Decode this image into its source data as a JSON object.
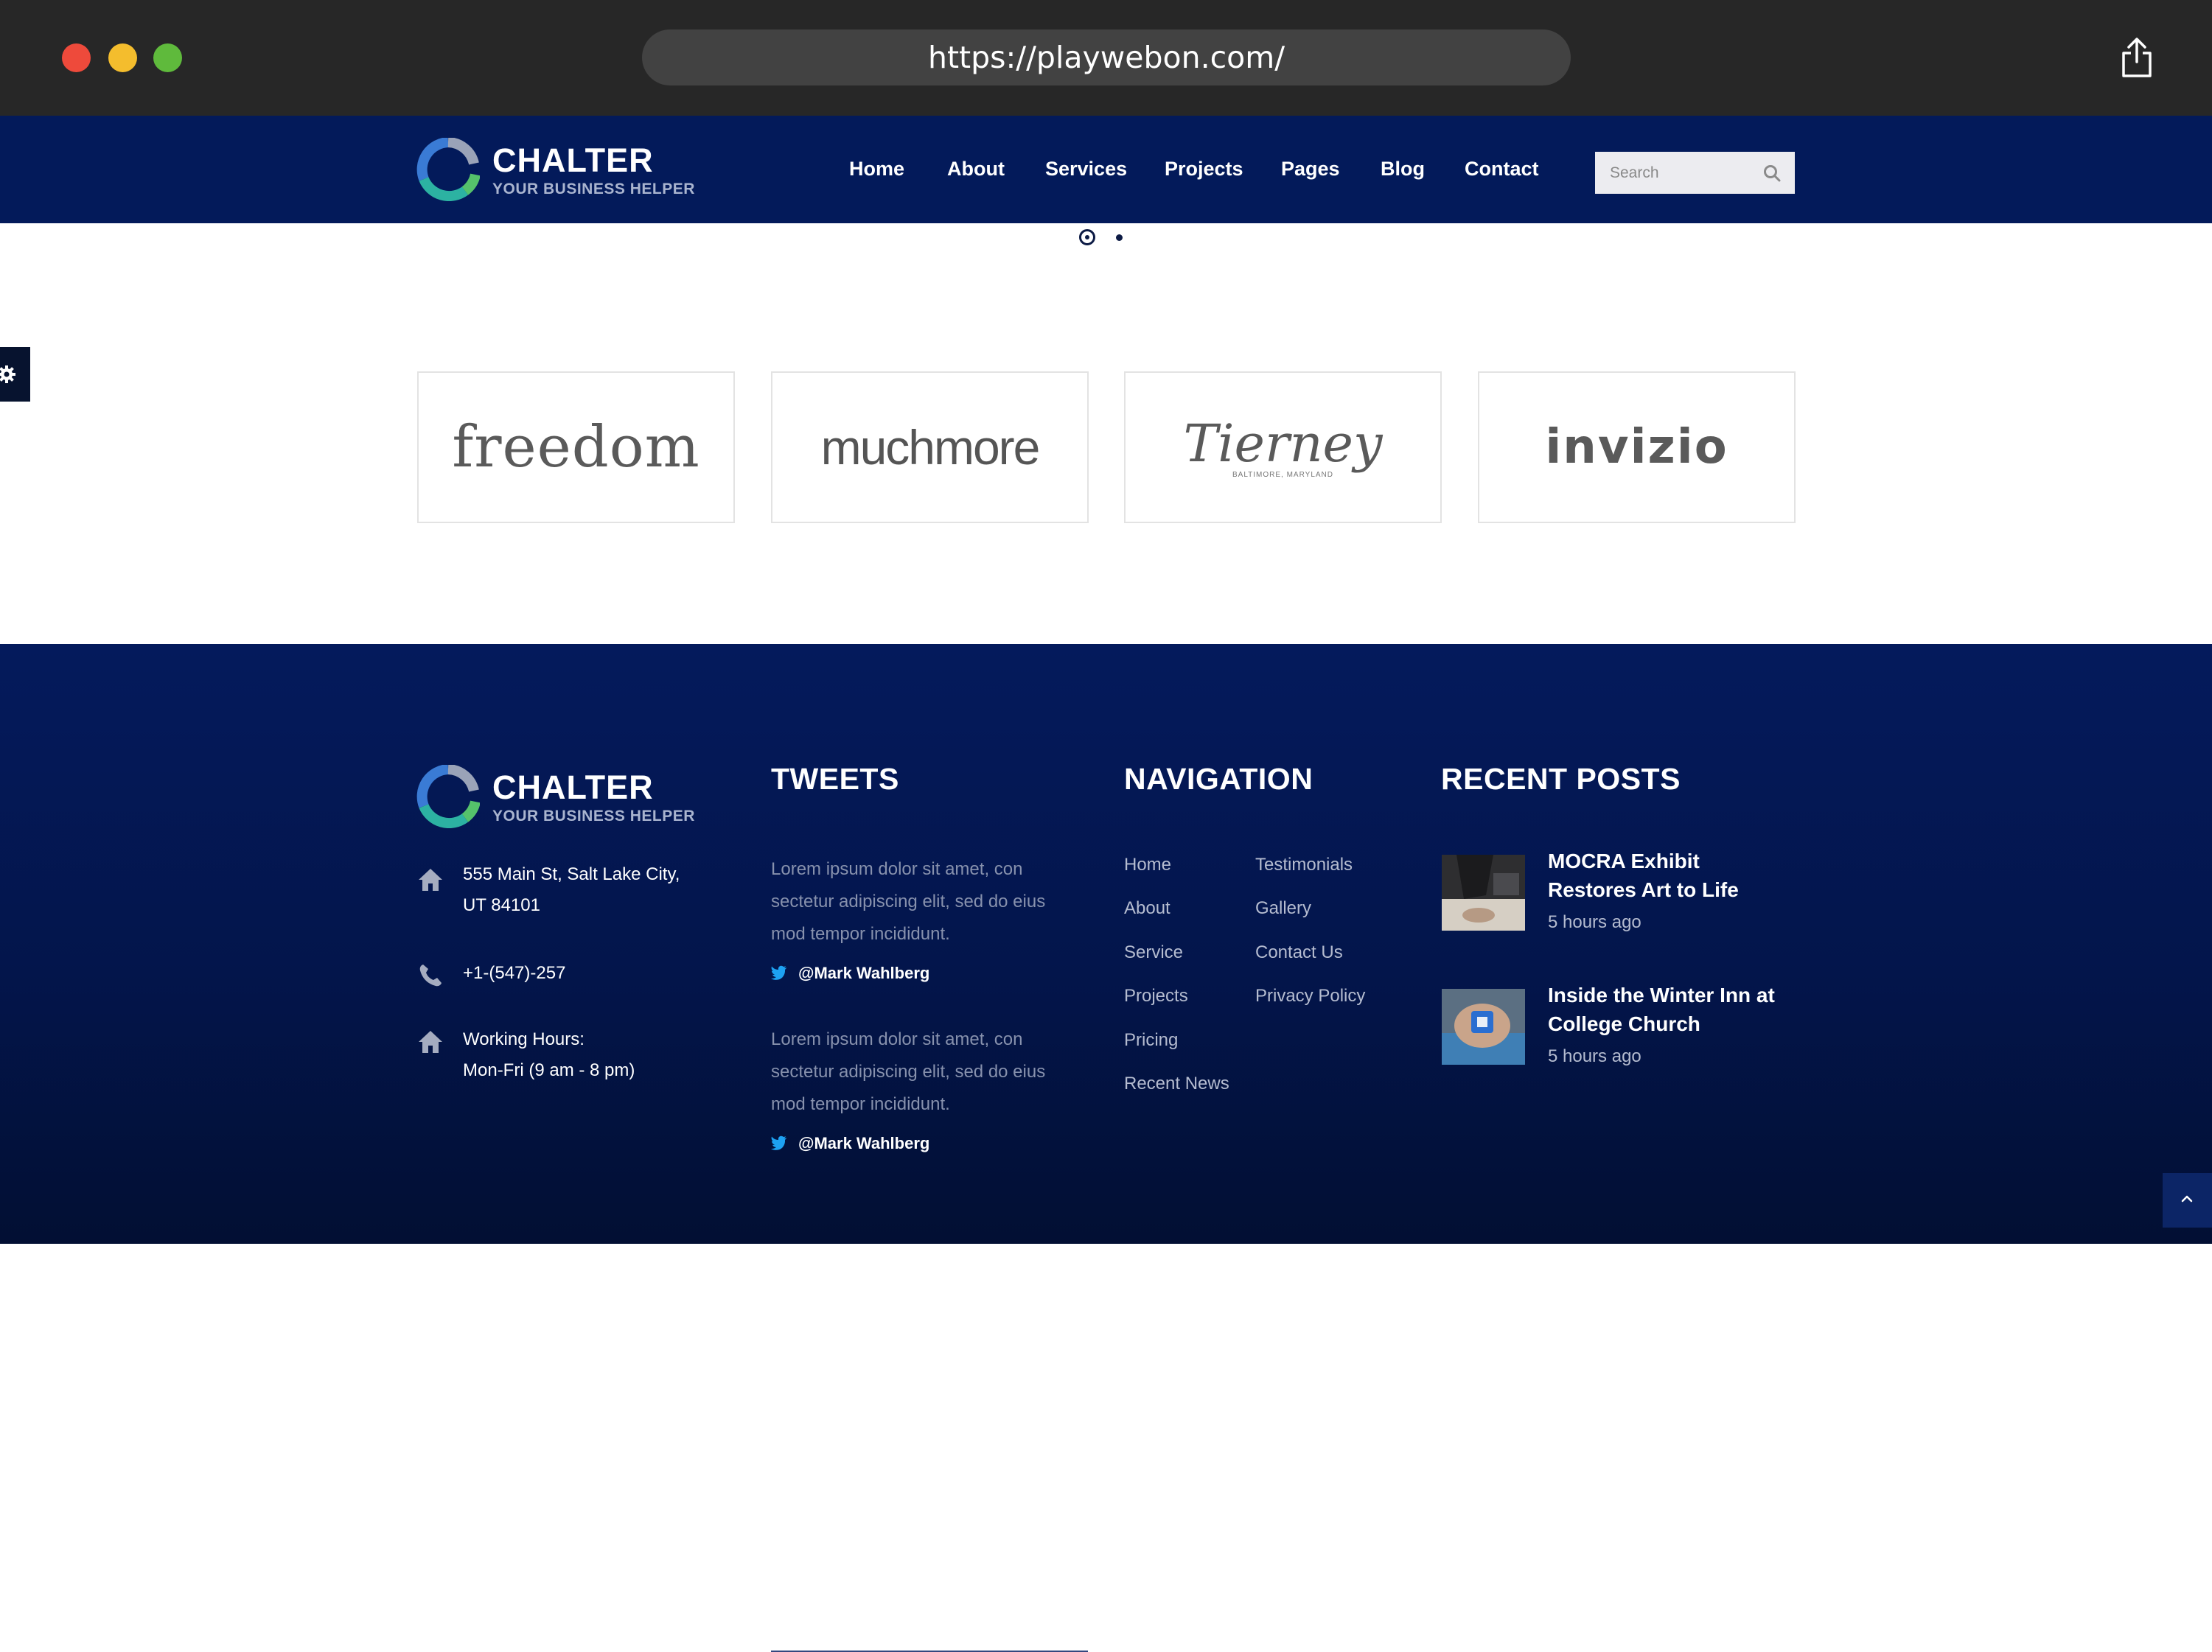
{
  "browser": {
    "url": "https://playwebon.com/",
    "traffic_lights": [
      "#ee4a3b",
      "#f4bd2d",
      "#5fba3c"
    ],
    "share_icon": "share-icon"
  },
  "header": {
    "logo_title": "CHALTER",
    "logo_subtitle": "YOUR BUSINESS HELPER",
    "nav": [
      "Home",
      "About",
      "Services",
      "Projects",
      "Pages",
      "Blog",
      "Contact"
    ],
    "search_placeholder": "Search",
    "search_icon": "search-icon",
    "background": "#031a5a"
  },
  "slider": {
    "active_index": 0,
    "count": 2
  },
  "settings_icon": "gear-icon",
  "brands": [
    "freedom",
    "muchmore",
    "Tierney",
    "BALTIMORE, MARYLAND",
    "invizio"
  ],
  "footer": {
    "logo_title": "CHALTER",
    "logo_subtitle": "YOUR BUSINESS HELPER",
    "address_line1": "555 Main St, Salt Lake City,",
    "address_line2": "UT 84101",
    "phone": "+1-(547)-257",
    "hours_line1": "Working Hours:",
    "hours_line2": "Mon-Fri (9 am - 8 pm)",
    "tweets_title": "TWEETS",
    "tweets": [
      {
        "line1": "Lorem ipsum dolor sit amet, con",
        "line2": "sectetur adipiscing elit, sed do eius",
        "line3": "mod tempor incididunt.",
        "handle": "@Mark Wahlberg"
      },
      {
        "line1": "Lorem ipsum dolor sit amet, con",
        "line2": "sectetur adipiscing elit, sed do eius",
        "line3": "mod tempor incididunt.",
        "handle": "@Mark Wahlberg"
      }
    ],
    "navigation_title": "NAVIGATION",
    "nav_col1": [
      "Home",
      "About",
      "Service",
      "Projects",
      "Pricing",
      "Recent News"
    ],
    "nav_col2": [
      "Testimonials",
      "Gallery",
      "Contact Us",
      "Privacy Policy"
    ],
    "recent_title": "RECENT POSTS",
    "posts": [
      {
        "title": "MOCRA Exhibit Restores Art to Life",
        "date": "5 hours ago"
      },
      {
        "title": "Inside the Winter Inn at College Church",
        "date": "5 hours ago"
      }
    ],
    "back_to_top_icon": "chevron-up-icon"
  }
}
